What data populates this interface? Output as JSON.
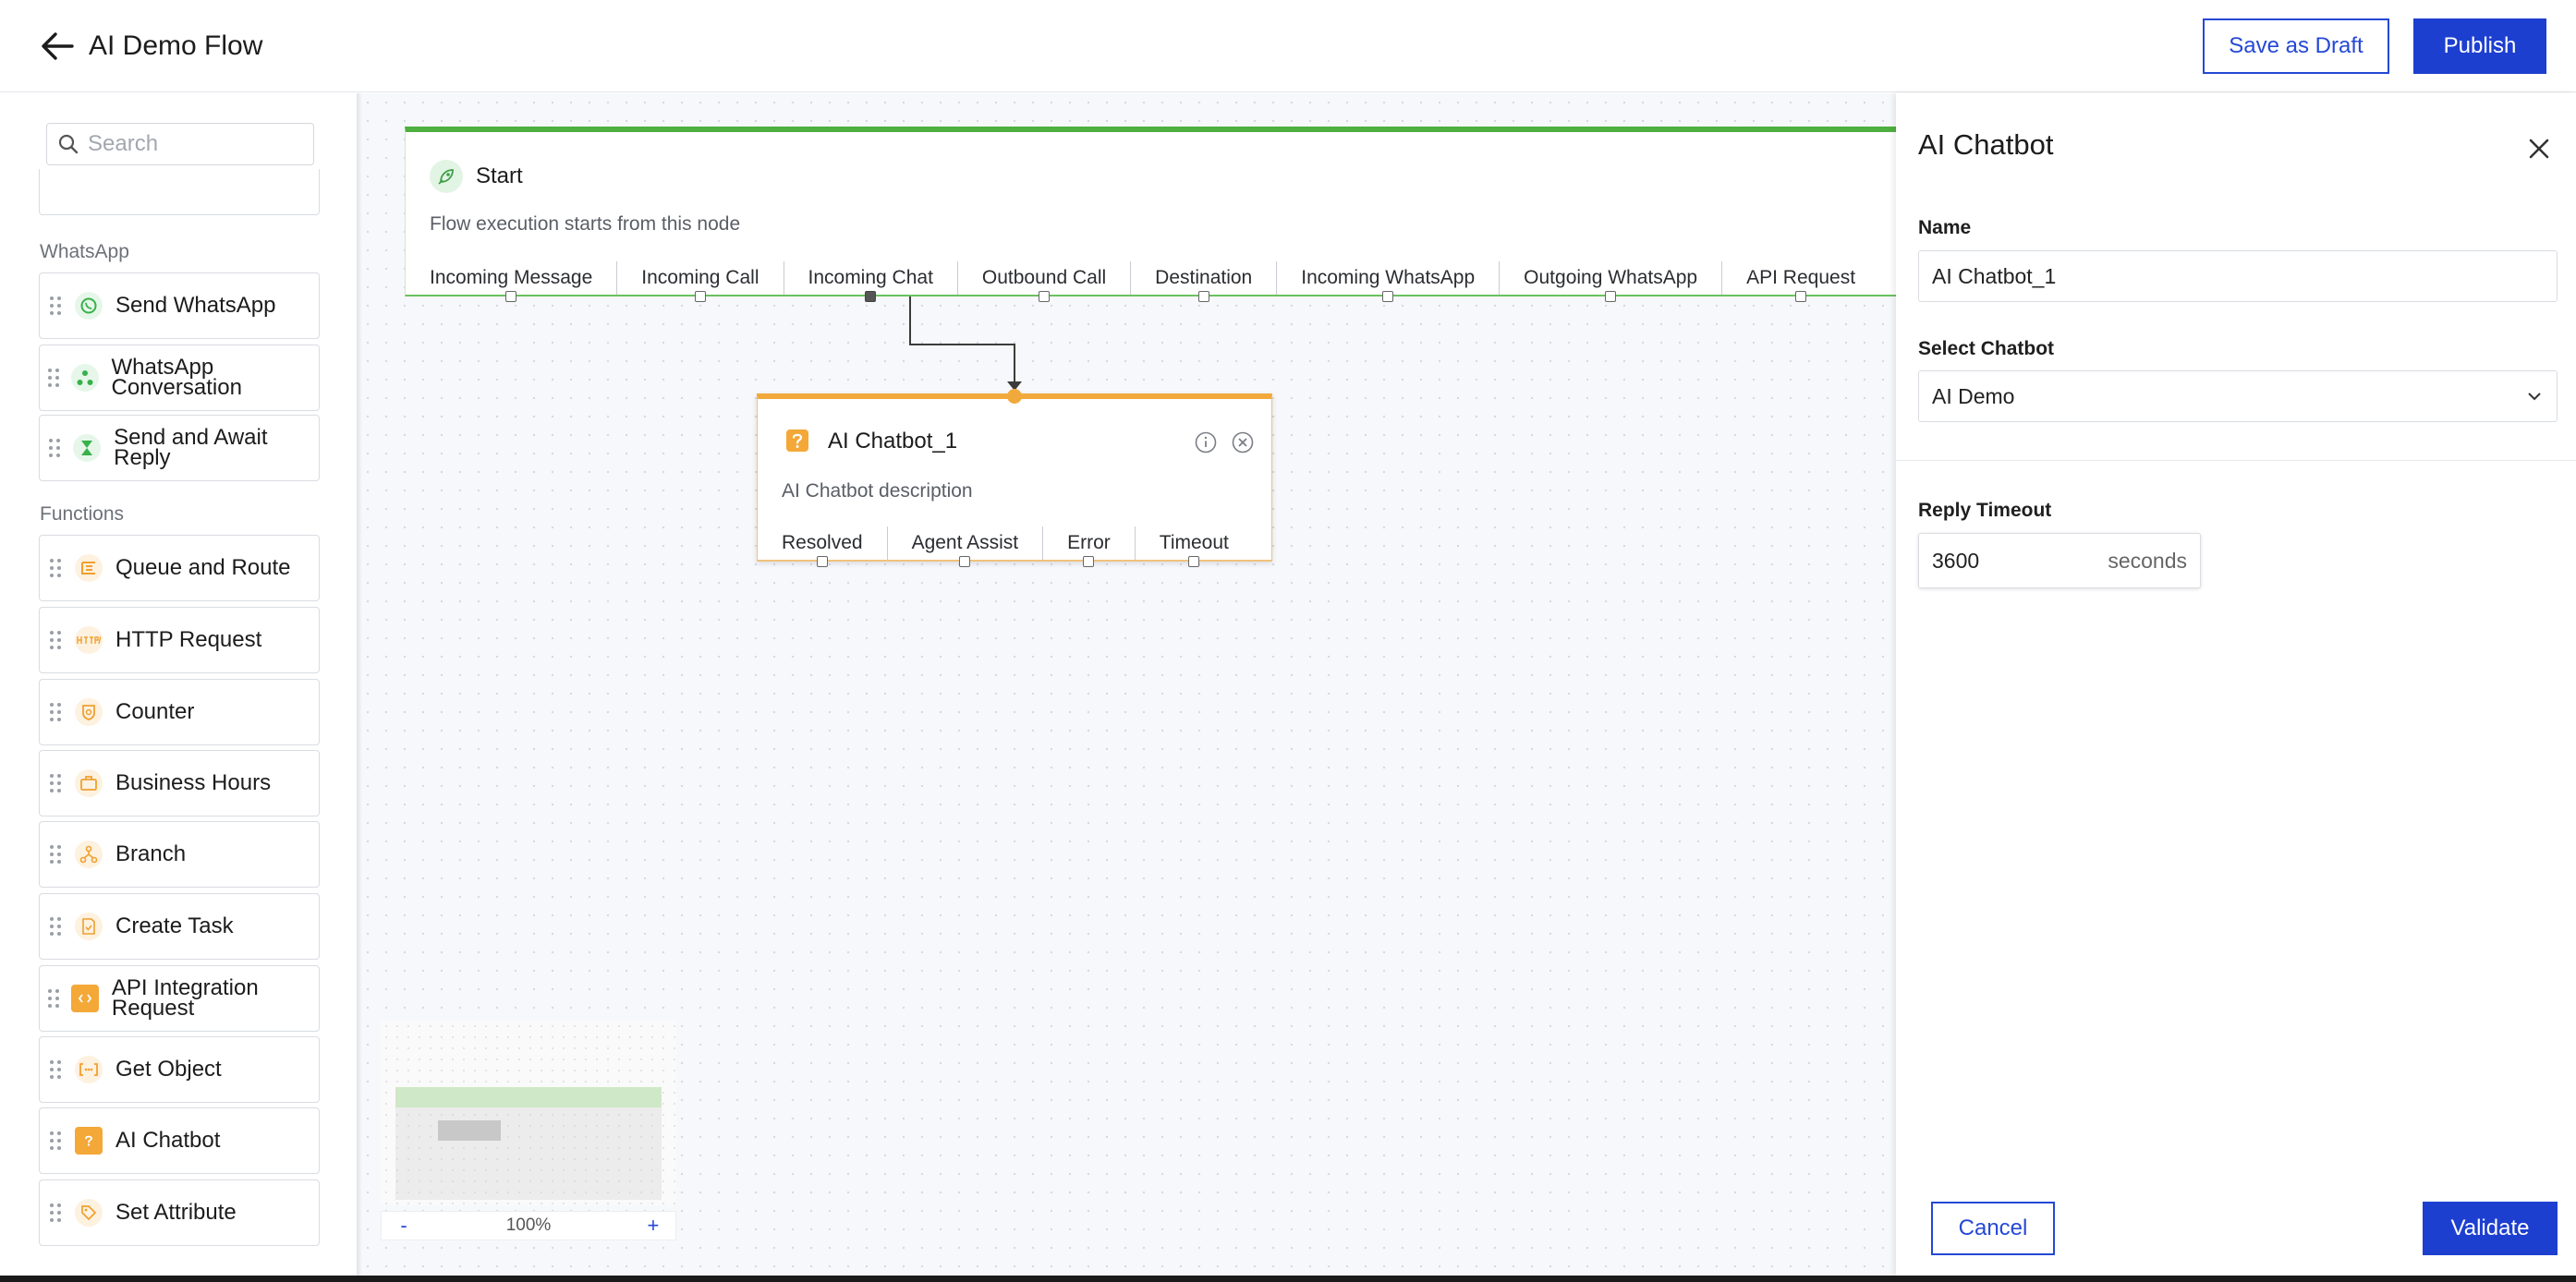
{
  "header": {
    "title": "AI Demo Flow",
    "save_draft_label": "Save as Draft",
    "publish_label": "Publish"
  },
  "sidebar": {
    "search_placeholder": "Search",
    "sections": [
      {
        "label": "WhatsApp",
        "items": [
          {
            "label": "Send WhatsApp",
            "icon": "whatsapp-icon"
          },
          {
            "label": "WhatsApp Conversation",
            "icon": "conversation-icon"
          },
          {
            "label": "Send and Await Reply",
            "icon": "hourglass-icon"
          }
        ]
      },
      {
        "label": "Functions",
        "items": [
          {
            "label": "Queue and Route",
            "icon": "queue-icon"
          },
          {
            "label": "HTTP Request",
            "icon": "http-icon"
          },
          {
            "label": "Counter",
            "icon": "counter-icon"
          },
          {
            "label": "Business Hours",
            "icon": "briefcase-icon"
          },
          {
            "label": "Branch",
            "icon": "branch-icon"
          },
          {
            "label": "Create Task",
            "icon": "task-icon"
          },
          {
            "label": "API Integration Request",
            "icon": "api-icon"
          },
          {
            "label": "Get Object",
            "icon": "object-icon"
          },
          {
            "label": "AI Chatbot",
            "icon": "chatbot-icon"
          },
          {
            "label": "Set Attribute",
            "icon": "tag-icon"
          }
        ]
      }
    ]
  },
  "canvas": {
    "start_node": {
      "title": "Start",
      "description": "Flow execution starts from this node",
      "outputs": [
        "Incoming Message",
        "Incoming Call",
        "Incoming Chat",
        "Outbound Call",
        "Destination",
        "Incoming WhatsApp",
        "Outgoing WhatsApp",
        "API Request"
      ]
    },
    "ai_node": {
      "title": "AI Chatbot_1",
      "description": "AI Chatbot description",
      "outputs": [
        "Resolved",
        "Agent Assist",
        "Error",
        "Timeout"
      ]
    },
    "zoom": {
      "minus": "-",
      "level": "100%",
      "plus": "+"
    }
  },
  "panel": {
    "title": "AI Chatbot",
    "name_label": "Name",
    "name_value": "AI Chatbot_1",
    "select_label": "Select Chatbot",
    "select_value": "AI Demo",
    "timeout_label": "Reply Timeout",
    "timeout_value": "3600",
    "timeout_unit": "seconds",
    "cancel_label": "Cancel",
    "validate_label": "Validate"
  },
  "colors": {
    "accent": "#1d3fd0",
    "start_node": "#4db03f",
    "ai_node": "#f2a93b"
  }
}
